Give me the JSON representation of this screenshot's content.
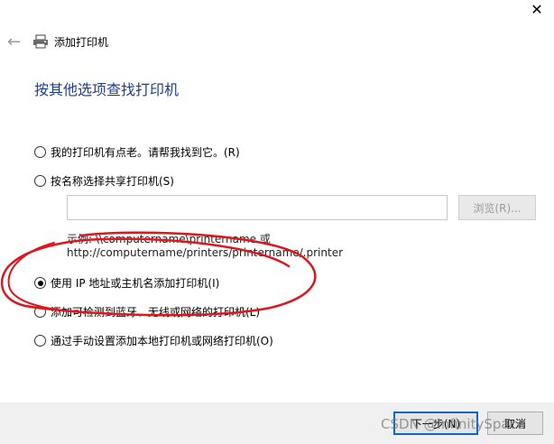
{
  "window": {
    "title": "添加打印机"
  },
  "heading": "按其他选项查找打印机",
  "options": [
    {
      "label": "我的打印机有点老。请帮我找到它。(R)",
      "checked": false
    },
    {
      "label": "按名称选择共享打印机(S)",
      "checked": false
    },
    {
      "label": "使用 IP 地址或主机名添加打印机(I)",
      "checked": true
    },
    {
      "label": "添加可检测到蓝牙、无线或网络的打印机(L)",
      "checked": false
    },
    {
      "label": "通过手动设置添加本地打印机或网络打印机(O)",
      "checked": false
    }
  ],
  "share_input": {
    "value": ""
  },
  "browse_label": "浏览(R)...",
  "example_line1": "示例: \\\\computername\\printername 或",
  "example_line2": "http://computername/printers/printername/.printer",
  "footer": {
    "next_label": "下一步(N)",
    "cancel_label": "取消"
  },
  "watermark": "CSDN @InfinitySpace",
  "icons": {
    "back": "back-arrow-icon",
    "printer": "printer-icon",
    "close": "close-icon"
  },
  "colors": {
    "heading": "#1d3f91",
    "primary_button_border": "#0a64d6",
    "annotation": "#e0161d"
  }
}
